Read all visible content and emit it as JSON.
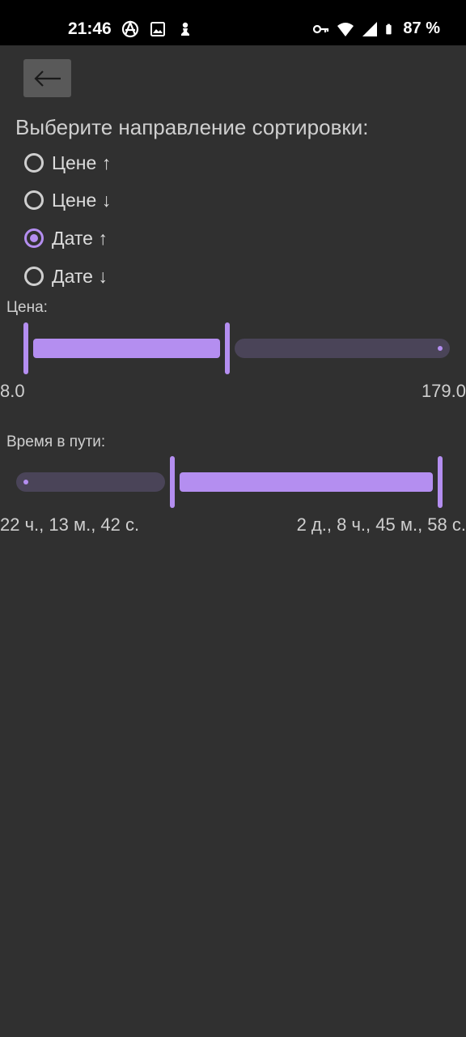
{
  "status_bar": {
    "time": "21:46",
    "battery": "87 %",
    "left_icons": [
      "vpn-anarchy-icon",
      "image-icon",
      "chess-pawn-icon"
    ],
    "right_icons": [
      "key-icon",
      "wifi-icon",
      "signal-icon",
      "battery-icon"
    ]
  },
  "toolbar": {
    "back_icon": "arrow-left-icon"
  },
  "sort": {
    "title": "Выберите направление сортировки:",
    "options": [
      {
        "label": "Цене ↑",
        "checked": false
      },
      {
        "label": "Цене ↓",
        "checked": false
      },
      {
        "label": "Дате ↑",
        "checked": true
      },
      {
        "label": "Дате ↓",
        "checked": false
      }
    ]
  },
  "price": {
    "caption": "Цена:",
    "min_label": "8.0",
    "max_label": "179.0",
    "min": 8.0,
    "max": 179.0,
    "lower_fraction": 0.0,
    "upper_fraction": 0.48
  },
  "travel_time": {
    "caption": "Время в пути:",
    "min_label": "22 ч., 13 м., 42 с.",
    "max_label": "2 д., 8 ч., 45 м., 58 с.",
    "lower_fraction": 0.37,
    "upper_fraction": 1.0
  },
  "colors": {
    "accent": "#b48ef0",
    "inactive_track": "#4a4458",
    "background": "#303030"
  }
}
